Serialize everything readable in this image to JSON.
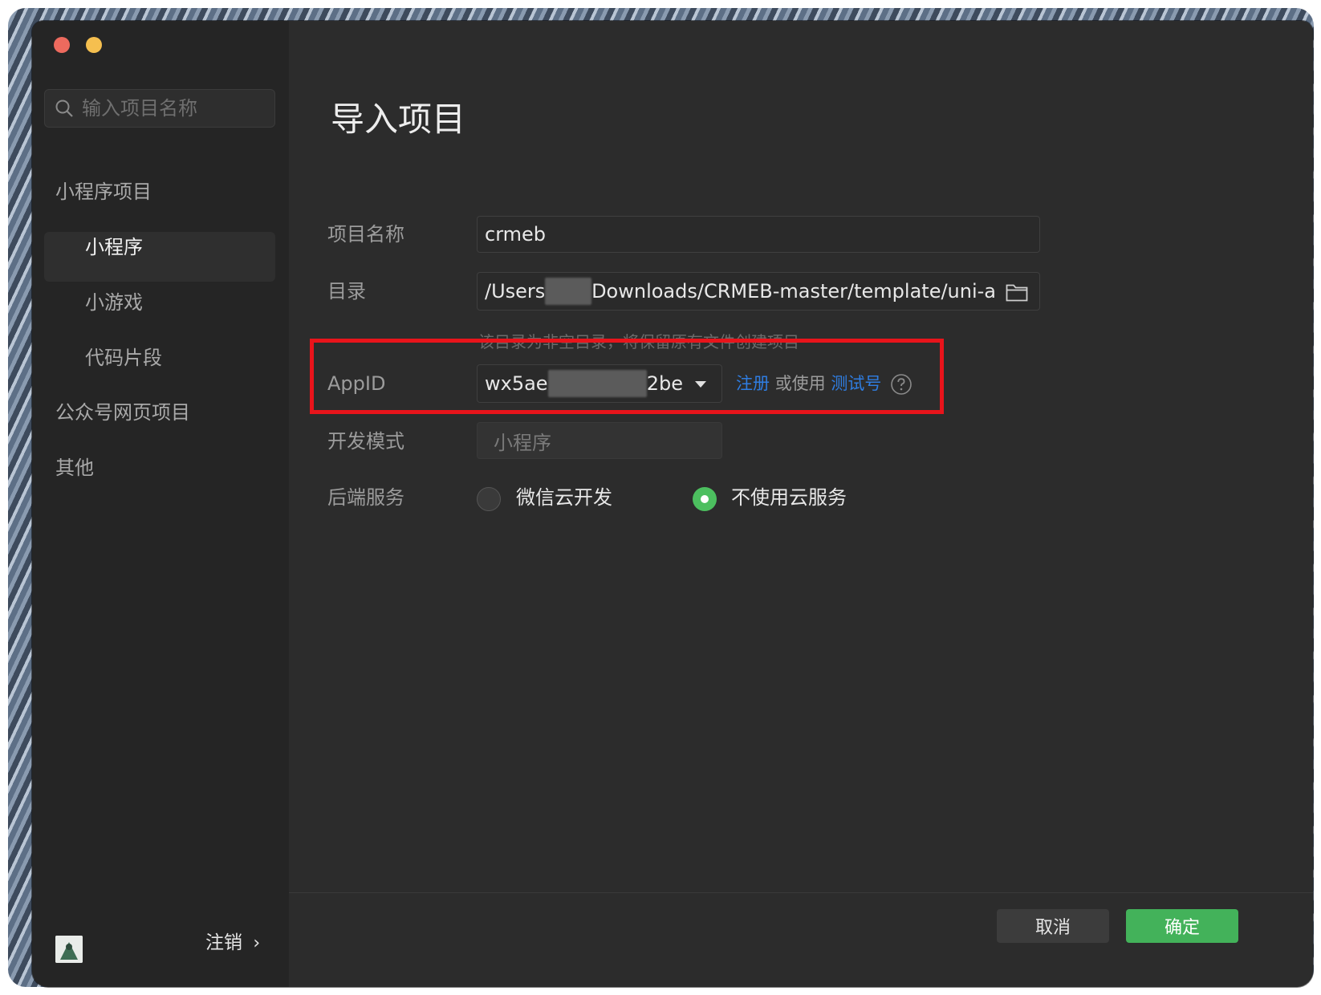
{
  "sidebar": {
    "search_placeholder": "输入项目名称",
    "sections": [
      {
        "label": "小程序项目"
      },
      {
        "label": "小程序"
      },
      {
        "label": "小游戏"
      },
      {
        "label": "代码片段"
      },
      {
        "label": "公众号网页项目"
      },
      {
        "label": "其他"
      }
    ],
    "logout_label": "注销"
  },
  "form": {
    "title": "导入项目",
    "project_name": {
      "label": "项目名称",
      "value": "crmeb"
    },
    "directory": {
      "label": "目录",
      "value_prefix": "/Users",
      "value_suffix": "Downloads/CRMEB-master/template/uni-a",
      "hint": "该目录为非空目录，将保留原有文件创建项目"
    },
    "appid": {
      "label": "AppID",
      "value_prefix": "wx5ae",
      "value_suffix": "2be",
      "register": "注册",
      "or_use": "或使用",
      "test_account": "测试号"
    },
    "dev_mode": {
      "label": "开发模式",
      "placeholder": "小程序"
    },
    "backend": {
      "label": "后端服务",
      "options": [
        {
          "label": "微信云开发",
          "selected": false
        },
        {
          "label": "不使用云服务",
          "selected": true
        }
      ]
    }
  },
  "footer": {
    "cancel_label": "取消",
    "confirm_label": "确定"
  },
  "colors": {
    "accent_green": "#43b25a",
    "link_blue": "#2f7de1",
    "highlight_red": "#e8141b"
  }
}
